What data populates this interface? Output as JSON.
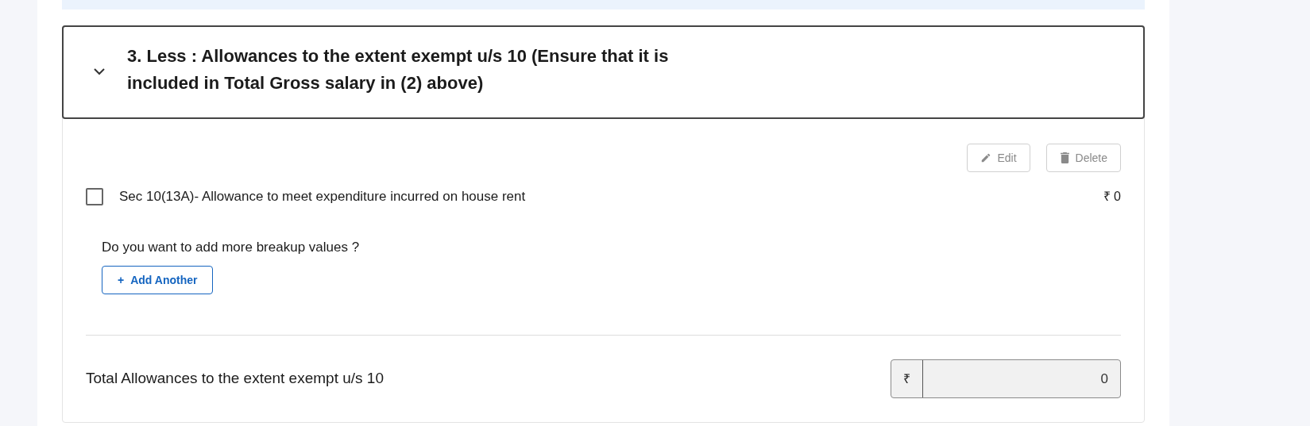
{
  "section": {
    "title": "3. Less : Allowances to the extent exempt u/s 10 (Ensure that it is included in Total Gross salary in (2) above)",
    "expanded": true
  },
  "actions": [
    {
      "kind": "edit",
      "label": "Edit",
      "disabled": true
    },
    {
      "kind": "delete",
      "label": "Delete",
      "disabled": true
    }
  ],
  "items": [
    {
      "label": "Sec 10(13A)- Allowance to meet expenditure incurred on house rent",
      "amount": "₹ 0",
      "checked": false
    }
  ],
  "breakup_prompt": "Do you want to add more breakup values ?",
  "add_button": {
    "icon": "+",
    "label": "Add Another"
  },
  "total": {
    "label": "Total Allowances to the extent exempt u/s 10",
    "currency": "₹",
    "value": "0"
  }
}
